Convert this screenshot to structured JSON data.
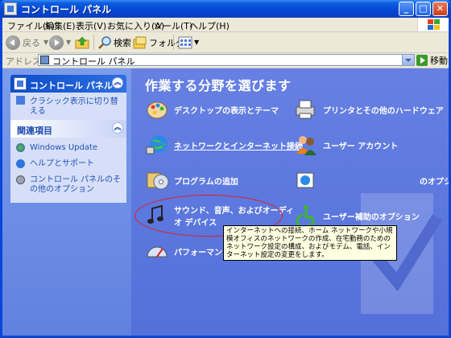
{
  "window": {
    "title": "コントロール パネル",
    "controls": {
      "minimize": "_",
      "maximize": "□",
      "close": "✕"
    }
  },
  "menu": {
    "items": [
      "ファイル(F)",
      "編集(E)",
      "表示(V)",
      "お気に入り(A)",
      "ツール(T)",
      "ヘルプ(H)"
    ]
  },
  "toolbar": {
    "back_label": "戻る",
    "search_label": "検索",
    "folders_label": "フォルダ"
  },
  "address": {
    "label": "アドレス(D)",
    "value": "コントロール パネル",
    "go_label": "移動"
  },
  "sidebar": {
    "panel": {
      "title": "コントロール パネル",
      "items": [
        {
          "label": "クラシック表示に切り替える",
          "icon": "classic-view-icon"
        }
      ]
    },
    "related": {
      "title": "関連項目",
      "items": [
        {
          "label": "Windows Update",
          "icon": "windows-update-icon"
        },
        {
          "label": "ヘルプとサポート",
          "icon": "help-icon"
        },
        {
          "label": "コントロール パネルのその他のオプション",
          "icon": "options-icon"
        }
      ]
    }
  },
  "main": {
    "heading": "作業する分野を選びます",
    "categories_left": [
      {
        "label": "デスクトップの表示とテーマ",
        "icon": "appearance-icon"
      },
      {
        "label": "ネットワークとインターネット接続",
        "icon": "network-icon"
      },
      {
        "label": "プログラムの追加",
        "icon": "add-programs-icon"
      },
      {
        "label": "サウンド、音声、およびオーディオ デバイス",
        "icon": "sound-icon"
      },
      {
        "label": "パフォーマンスとメンテナンス",
        "icon": "performance-icon"
      }
    ],
    "categories_right": [
      {
        "label": "プリンタとその他のハードウェア",
        "icon": "printer-icon"
      },
      {
        "label": "ユーザー アカウント",
        "icon": "users-icon"
      },
      {
        "label": "のオプション",
        "icon": "regional-icon"
      },
      {
        "label": "ユーザー補助のオプション",
        "icon": "accessibility-icon"
      }
    ],
    "tooltip": "インターネットへの接続、ホーム ネットワークや小規模オフィスのネットワークの作成、在宅勤務のためのネットワーク設定の構成、およびモデム、電話、インターネット設定の変更をします。"
  }
}
